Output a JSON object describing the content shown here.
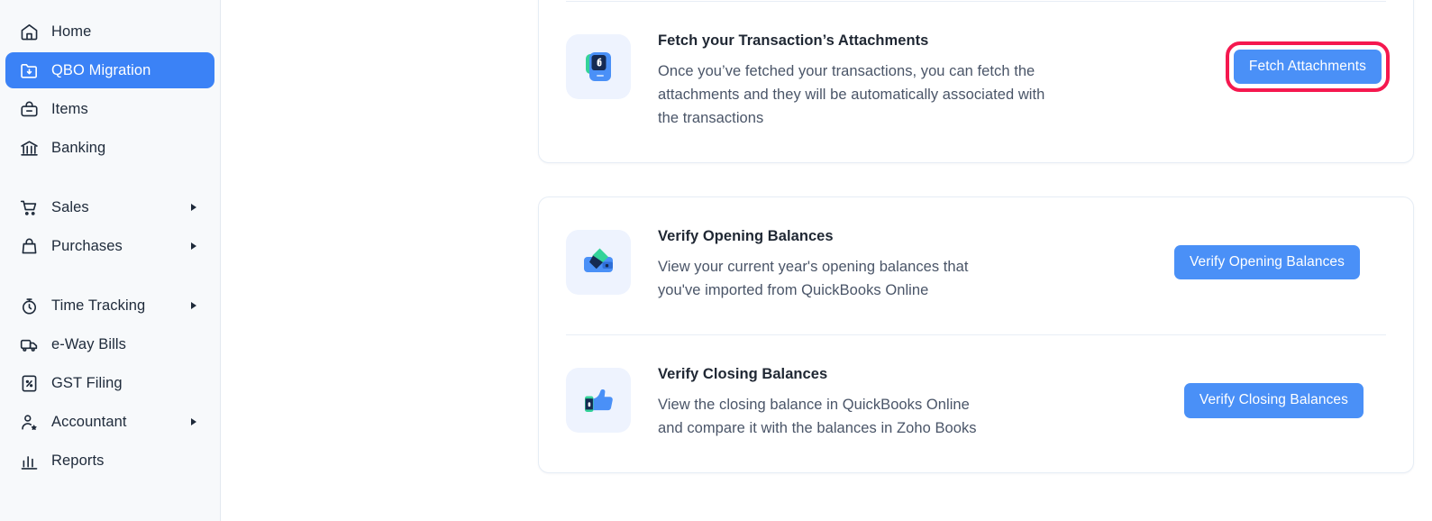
{
  "sidebar": {
    "groups": [
      {
        "items": [
          {
            "label": "Home",
            "icon": "home-icon",
            "active": false,
            "expandable": false
          },
          {
            "label": "QBO Migration",
            "icon": "folder-migration-icon",
            "active": true,
            "expandable": false
          },
          {
            "label": "Items",
            "icon": "basket-icon",
            "active": false,
            "expandable": false
          },
          {
            "label": "Banking",
            "icon": "bank-icon",
            "active": false,
            "expandable": false
          }
        ]
      },
      {
        "items": [
          {
            "label": "Sales",
            "icon": "cart-icon",
            "active": false,
            "expandable": true
          },
          {
            "label": "Purchases",
            "icon": "bag-icon",
            "active": false,
            "expandable": true
          }
        ]
      },
      {
        "items": [
          {
            "label": "Time Tracking",
            "icon": "stopwatch-icon",
            "active": false,
            "expandable": true
          },
          {
            "label": "e-Way Bills",
            "icon": "truck-icon",
            "active": false,
            "expandable": false
          },
          {
            "label": "GST Filing",
            "icon": "percent-document-icon",
            "active": false,
            "expandable": false
          },
          {
            "label": "Accountant",
            "icon": "person-star-icon",
            "active": false,
            "expandable": true
          },
          {
            "label": "Reports",
            "icon": "bar-chart-icon",
            "active": false,
            "expandable": false
          }
        ]
      }
    ],
    "accent_color": "#3b82f6",
    "background_color": "#f7f9fb"
  },
  "main": {
    "card1": {
      "rows": [
        {
          "icon": "attachment-document-icon",
          "title": "Fetch your Transaction’s Attachments",
          "description": "Once you’ve fetched your transactions, you can fetch the attachments and they will be automatically associated with the transactions",
          "button_label": "Fetch Attachments",
          "highlighted": true
        }
      ]
    },
    "card2": {
      "rows": [
        {
          "icon": "wallet-icon",
          "title": "Verify Opening Balances",
          "description": "View your current year's opening balances that you've imported from QuickBooks Online",
          "button_label": "Verify Opening Balances",
          "highlighted": false
        },
        {
          "icon": "thumbs-up-icon",
          "title": "Verify Closing Balances",
          "description": "View the closing balance in QuickBooks Online and compare it with the balances in Zoho Books",
          "button_label": "Verify Closing Balances",
          "highlighted": false
        }
      ]
    },
    "button_color": "#4a90f7",
    "highlight_color": "#f5184f"
  }
}
